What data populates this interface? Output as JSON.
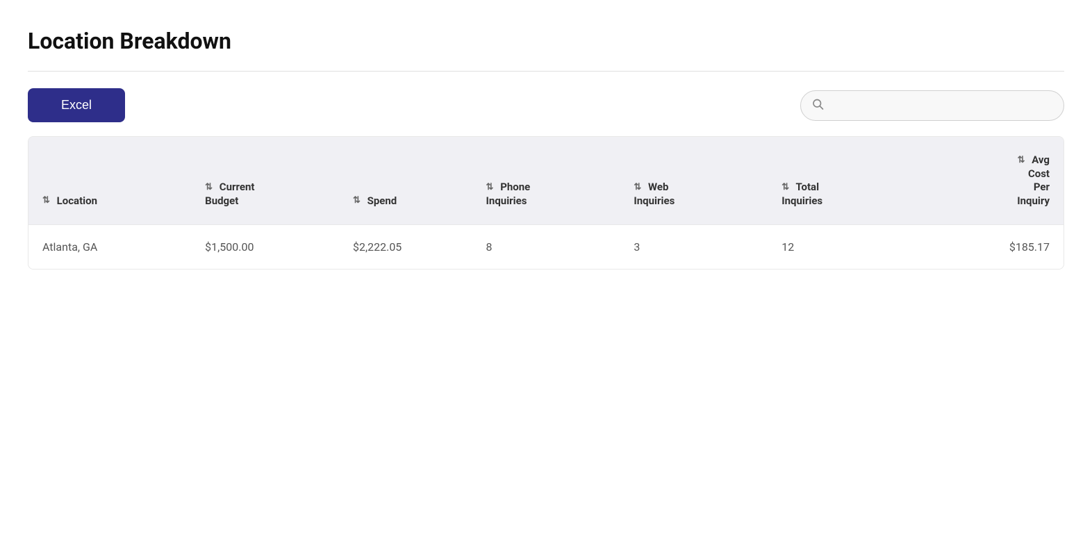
{
  "page": {
    "title": "Location Breakdown"
  },
  "toolbar": {
    "excel_label": "Excel",
    "search_placeholder": ""
  },
  "table": {
    "columns": [
      {
        "id": "location",
        "label": "Location"
      },
      {
        "id": "current_budget",
        "label": "Current Budget"
      },
      {
        "id": "spend",
        "label": "Spend"
      },
      {
        "id": "phone_inquiries",
        "label": "Phone Inquiries"
      },
      {
        "id": "web_inquiries",
        "label": "Web Inquiries"
      },
      {
        "id": "total_inquiries",
        "label": "Total Inquiries"
      },
      {
        "id": "avg_cost",
        "label": "Avg Cost Per Inquiry"
      }
    ],
    "rows": [
      {
        "location": "Atlanta, GA",
        "current_budget": "$1,500.00",
        "spend": "$2,222.05",
        "phone_inquiries": "8",
        "web_inquiries": "3",
        "total_inquiries": "12",
        "avg_cost": "$185.17"
      }
    ]
  },
  "icons": {
    "search": "🔍",
    "sort": "⇅"
  }
}
